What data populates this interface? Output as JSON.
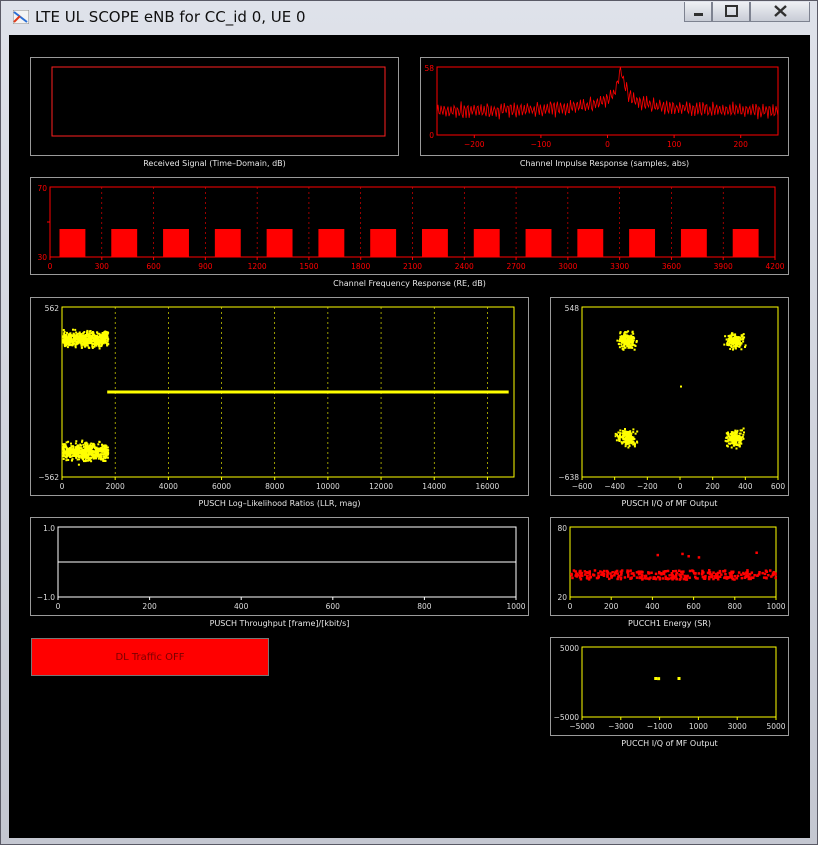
{
  "window": {
    "title": "LTE UL SCOPE eNB for CC_id 0, UE 0",
    "controls": [
      "minimize",
      "maximize",
      "close"
    ]
  },
  "colors": {
    "red": "#ff0000",
    "yellow": "#ffff00",
    "background": "#000000",
    "axis_red": "#ff2020"
  },
  "dl_button": {
    "label": "DL Traffic OFF"
  },
  "chart_data": [
    {
      "id": "received-signal",
      "type": "line",
      "title": "Received Signal (Time–Domain, dB)",
      "series": [],
      "color": "#ff0000"
    },
    {
      "id": "channel-impulse",
      "type": "line",
      "title": "Channel Impulse Response (samples, abs)",
      "xlim": [
        -256,
        256
      ],
      "ylim": [
        0,
        58
      ],
      "xticks": [
        "−200",
        "−100",
        "0",
        "100",
        "200"
      ],
      "yticks": [
        "0",
        "58"
      ],
      "color": "#ff0000",
      "series": [
        {
          "peak_x": 20,
          "peak_y": 58,
          "floor_y": 20
        }
      ]
    },
    {
      "id": "channel-frequency",
      "type": "bar",
      "title": "Channel Frequency Response (RE, dB)",
      "xlim": [
        0,
        4200
      ],
      "ylim": [
        30,
        70
      ],
      "xticks": [
        "0",
        "300",
        "600",
        "900",
        "1200",
        "1500",
        "1800",
        "2100",
        "2400",
        "2700",
        "3000",
        "3300",
        "3600",
        "3900",
        "4200"
      ],
      "yticks": [
        "30",
        "70"
      ],
      "color": "#ff0000",
      "bar_centers": [
        130,
        430,
        730,
        1030,
        1330,
        1630,
        1930,
        2230,
        2530,
        2830,
        3130,
        3430,
        3730,
        4030
      ],
      "bar_width": 150,
      "bar_top": 46
    },
    {
      "id": "pusch-llr",
      "type": "scatter",
      "title": "PUSCH Log–Likelihood Ratios (LLR, mag)",
      "xlim": [
        0,
        17000
      ],
      "ylim": [
        -562,
        562
      ],
      "xticks": [
        "0",
        "2000",
        "4000",
        "6000",
        "8000",
        "10000",
        "12000",
        "14000",
        "16000"
      ],
      "yticks": [
        "−562",
        "562"
      ],
      "color": "#ffff00",
      "clusters": [
        {
          "x": [
            0,
            1700
          ],
          "y": [
            280,
            430
          ]
        },
        {
          "x": [
            0,
            1700
          ],
          "y": [
            -480,
            -300
          ]
        }
      ],
      "line": {
        "x": [
          1700,
          16800
        ],
        "y": 0
      }
    },
    {
      "id": "pusch-iq",
      "type": "scatter",
      "title": "PUSCH I/Q of MF Output",
      "xlim": [
        -600,
        600
      ],
      "ylim": [
        -638,
        548
      ],
      "xticks": [
        "−600",
        "−400",
        "−200",
        "0",
        "200",
        "400",
        "600"
      ],
      "yticks": [
        "−638",
        "548"
      ],
      "color": "#ffff00",
      "clusters": [
        {
          "x": -330,
          "y": 320
        },
        {
          "x": 330,
          "y": 320
        },
        {
          "x": -330,
          "y": -360
        },
        {
          "x": 330,
          "y": -360
        }
      ],
      "outliers": [
        {
          "x": 0,
          "y": 0
        }
      ]
    },
    {
      "id": "pusch-throughput",
      "type": "line",
      "title": "PUSCH Throughput [frame]/[kbit/s]",
      "xlim": [
        0,
        1000
      ],
      "ylim": [
        -1,
        1
      ],
      "xticks": [
        "0",
        "200",
        "400",
        "600",
        "800",
        "1000"
      ],
      "yticks": [
        "−1.0",
        "1.0"
      ],
      "color": "#ffffff",
      "series": [
        {
          "x": [
            0,
            1000
          ],
          "y": [
            0,
            0
          ]
        }
      ]
    },
    {
      "id": "pucch1-energy",
      "type": "scatter",
      "title": "PUCCH1 Energy (SR)",
      "xlim": [
        0,
        1000
      ],
      "ylim": [
        20,
        80
      ],
      "xticks": [
        "0",
        "200",
        "400",
        "600",
        "800",
        "1000"
      ],
      "yticks": [
        "20",
        "80"
      ],
      "color": "#ff0000",
      "band": {
        "y": [
          36,
          44
        ]
      },
      "outliers": [
        {
          "x": 420,
          "y": 57
        },
        {
          "x": 540,
          "y": 58
        },
        {
          "x": 570,
          "y": 56
        },
        {
          "x": 620,
          "y": 55
        },
        {
          "x": 900,
          "y": 59
        },
        {
          "x": 80,
          "y": 42
        }
      ]
    },
    {
      "id": "pucch-iq",
      "type": "scatter",
      "title": "PUCCH I/Q of MF Output",
      "xlim": [
        -5000,
        5000
      ],
      "ylim": [
        -5000,
        5000
      ],
      "xticks": [
        "−5000",
        "−3000",
        "−1000",
        "1000",
        "3000",
        "5000"
      ],
      "yticks": [
        "−5000",
        "5000"
      ],
      "color": "#ffff00",
      "points": [
        {
          "x": -1200,
          "y": 500
        },
        {
          "x": -1050,
          "y": 480
        },
        {
          "x": 0,
          "y": 500
        }
      ]
    }
  ]
}
